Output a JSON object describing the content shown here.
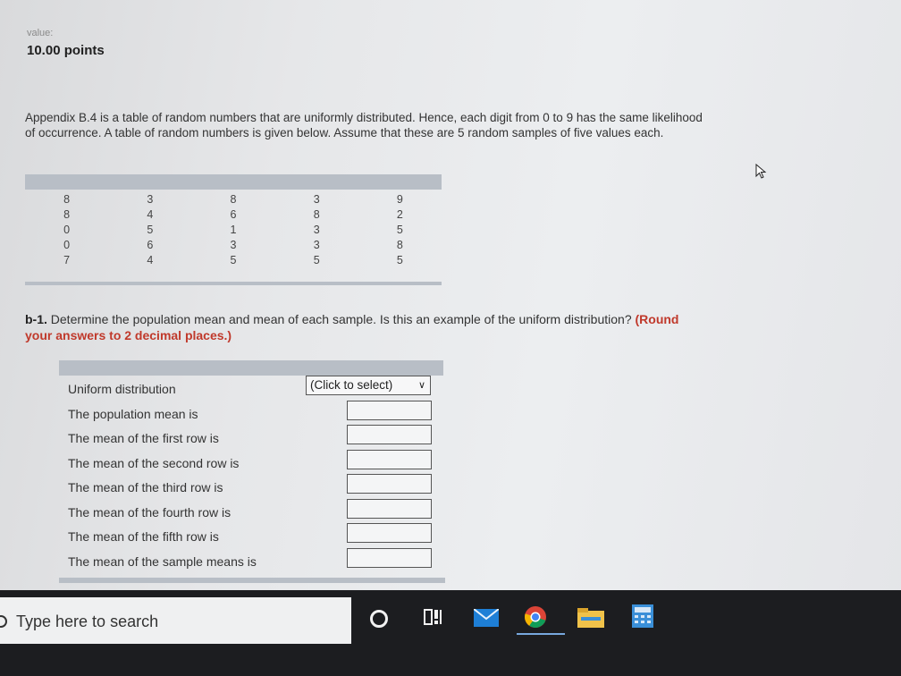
{
  "header": {
    "value_label": "value:",
    "points": "10.00 points"
  },
  "intro_text": "Appendix B.4 is a table of random numbers that are uniformly distributed. Hence, each digit from 0 to 9 has the same likelihood of occurrence. A table of random numbers is given below. Assume that these are 5 random samples of five values each.",
  "random_table": {
    "columns": [
      [
        "8",
        "8",
        "0",
        "0",
        "7"
      ],
      [
        "3",
        "4",
        "5",
        "6",
        "4"
      ],
      [
        "8",
        "6",
        "1",
        "3",
        "5"
      ],
      [
        "3",
        "8",
        "3",
        "3",
        "5"
      ],
      [
        "9",
        "2",
        "5",
        "8",
        "5"
      ]
    ]
  },
  "question": {
    "number": "b-1.",
    "text": "Determine the population mean and mean of each sample. Is this an example of the uniform distribution?",
    "hint": "(Round your answers to 2 decimal places.)"
  },
  "answer_rows": [
    {
      "label": "Uniform distribution",
      "type": "select",
      "selected": "(Click to select)"
    },
    {
      "label": "The population mean is",
      "type": "input",
      "value": ""
    },
    {
      "label": "The mean of the first row is",
      "type": "input",
      "value": ""
    },
    {
      "label": "The mean of the second row is",
      "type": "input",
      "value": ""
    },
    {
      "label": "The mean of the third row is",
      "type": "input",
      "value": ""
    },
    {
      "label": "The mean of the fourth row is",
      "type": "input",
      "value": ""
    },
    {
      "label": "The mean of the fifth row is",
      "type": "input",
      "value": ""
    },
    {
      "label": "The mean of the sample means is",
      "type": "input",
      "value": ""
    }
  ],
  "taskbar": {
    "search_placeholder": "Type here to search",
    "icons": [
      "cortana-icon",
      "task-view-icon",
      "mail-icon",
      "chrome-icon",
      "file-explorer-icon",
      "calculator-icon"
    ],
    "colors": {
      "background": "#1c1d20",
      "mail": "#1e7fd6",
      "chrome_red": "#db4437",
      "chrome_yellow": "#f4b400",
      "chrome_green": "#0f9d58",
      "explorer": "#f0c24a",
      "calculator": "#3a8fd8"
    }
  }
}
